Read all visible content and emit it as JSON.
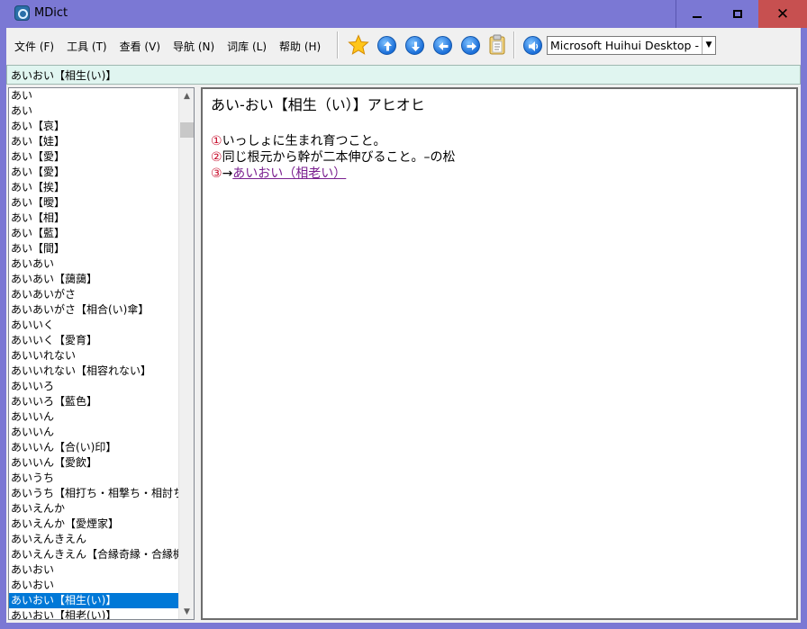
{
  "window": {
    "title": "MDict",
    "minimize": "—",
    "maximize": "☐",
    "close": "✕"
  },
  "menu": [
    "文件 (F)",
    "工具 (T)",
    "查看 (V)",
    "导航 (N)",
    "词库 (L)",
    "帮助 (H)"
  ],
  "toolbar": {
    "dictionary_selected": "Microsoft Huihui Desktop - Chinese"
  },
  "search": {
    "value": "あいおい【相生(い)】"
  },
  "word_list": [
    "あい",
    "あい",
    "あい【哀】",
    "あい【娃】",
    "あい【愛】",
    "あい【愛】",
    "あい【挨】",
    "あい【曖】",
    "あい【相】",
    "あい【藍】",
    "あい【間】",
    "あいあい",
    "あいあい【藹藹】",
    "あいあいがさ",
    "あいあいがさ【相合(い)傘】",
    "あいいく",
    "あいいく【愛育】",
    "あいいれない",
    "あいいれない【相容れない】",
    "あいいろ",
    "あいいろ【藍色】",
    "あいいん",
    "あいいん",
    "あいいん【合(い)印】",
    "あいいん【愛飲】",
    "あいうち",
    "あいうち【相打ち・相撃ち・相討ち】",
    "あいえんか",
    "あいえんか【愛煙家】",
    "あいえんきえん",
    "あいえんきえん【合縁奇縁・合縁機縁】",
    "あいおい",
    "あいおい",
    "あいおい【相生(い)】",
    "あいおい【相老(い)】"
  ],
  "selected_index": 33,
  "entry": {
    "headword": "あい‐おい【相生（い）】アヒオヒ",
    "definitions": [
      {
        "num": "①",
        "text": "いっしょに生まれ育つこと。"
      },
      {
        "num": "②",
        "text": "同じ根元から幹が二本伸びること。–の松"
      },
      {
        "num": "③",
        "text": "→",
        "link": "あいおい（相老い）"
      }
    ]
  },
  "colors": {
    "title_bar": "#7b78d4",
    "selection": "#0078d7",
    "search_bar": "#e0f5f0",
    "def_number": "#c8102e",
    "xref_link": "#7a1f8f"
  },
  "icons": [
    "mdict-app-icon",
    "star-icon",
    "arrow-up-icon",
    "arrow-down-icon",
    "arrow-left-icon",
    "arrow-right-icon",
    "clipboard-icon",
    "speaker-icon"
  ]
}
